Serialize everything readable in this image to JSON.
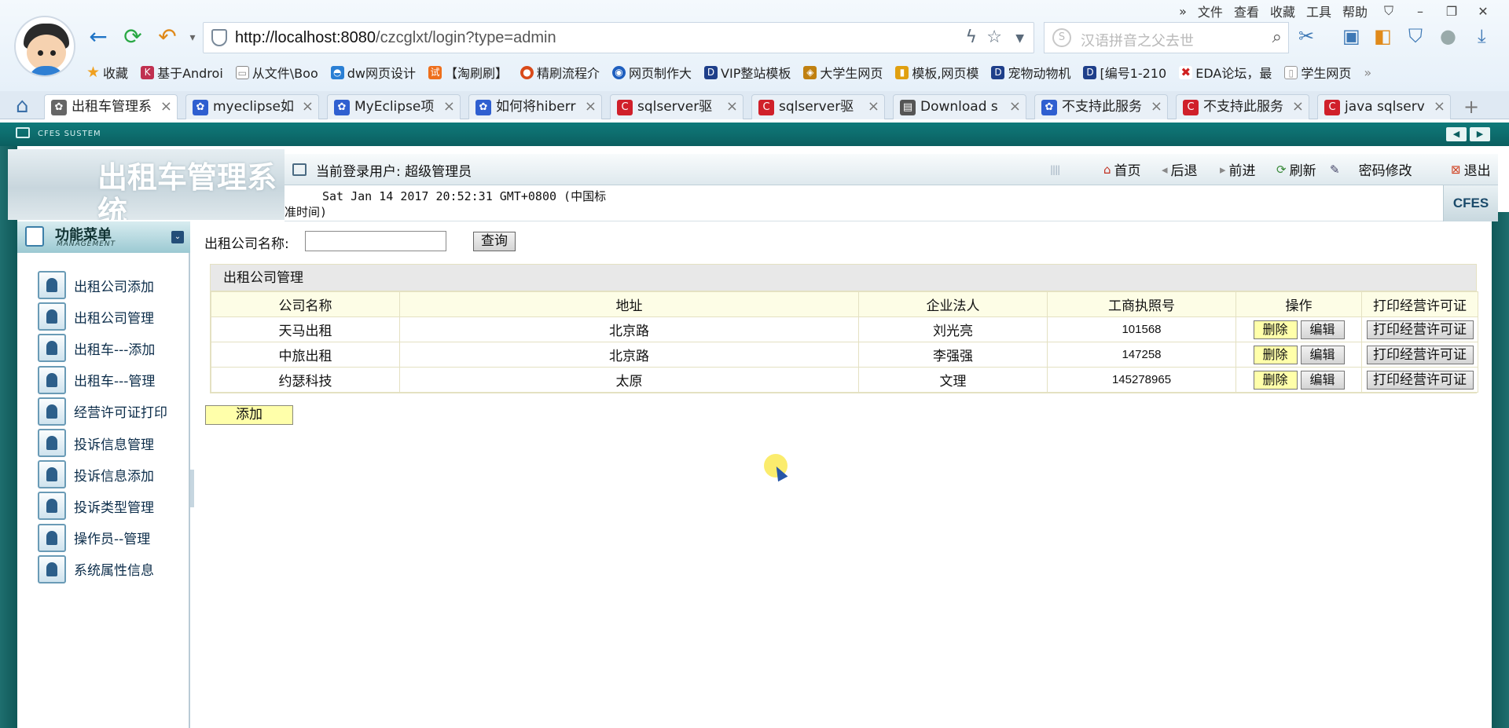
{
  "browser": {
    "url_host": "http://localhost:8080",
    "url_path": "/czcglxt/login?type=admin",
    "search_placeholder": "汉语拼音之父去世",
    "menubar": [
      "文件",
      "查看",
      "收藏",
      "工具",
      "帮助"
    ],
    "bookmarks": [
      "收藏",
      "基于Androi",
      "从文件\\Boo",
      "dw网页设计",
      "【淘刷刷】",
      "精刷流程介",
      "网页制作大",
      "VIP整站模板",
      "大学生网页",
      "模板,网页模",
      "宠物动物机",
      "[编号1-210",
      "EDA论坛，最",
      "学生网页"
    ],
    "tabs": [
      {
        "label": "出租车管理系",
        "active": true,
        "color": "#666"
      },
      {
        "label": "myeclipse如",
        "active": false,
        "color": "#2f5fd0"
      },
      {
        "label": "MyEclipse项",
        "active": false,
        "color": "#2f5fd0"
      },
      {
        "label": "如何将hiberr",
        "active": false,
        "color": "#2f5fd0"
      },
      {
        "label": "sqlserver驱",
        "active": false,
        "color": "#d0202a"
      },
      {
        "label": "sqlserver驱",
        "active": false,
        "color": "#d0202a"
      },
      {
        "label": "Download s",
        "active": false,
        "color": "#555"
      },
      {
        "label": "不支持此服务",
        "active": false,
        "color": "#2f5fd0"
      },
      {
        "label": "不支持此服务",
        "active": false,
        "color": "#d0202a"
      },
      {
        "label": "java sqlserv",
        "active": false,
        "color": "#d0202a"
      }
    ]
  },
  "app": {
    "system_label": "CFES SUSTEM",
    "logo_text": "出租车管理系统",
    "current_user_label": "当前登录用户: 超级管理员",
    "timestamp": "Sat Jan 14 2017 20:52:31 GMT+0800 (中国标准时间)",
    "badge": "CFES",
    "top_nav": [
      {
        "label": "首页",
        "icon": "home-icon"
      },
      {
        "label": "后退",
        "icon": "back-icon"
      },
      {
        "label": "前进",
        "icon": "forward-icon"
      },
      {
        "label": "刷新",
        "icon": "refresh-icon"
      },
      {
        "label": "密码修改",
        "icon": "password-icon"
      },
      {
        "label": "退出",
        "icon": "exit-icon"
      }
    ]
  },
  "sidebar": {
    "title": "功能菜单",
    "subtitle": "MANAGEMENT",
    "items": [
      {
        "label": "出租公司添加"
      },
      {
        "label": "出租公司管理"
      },
      {
        "label": "出租车---添加"
      },
      {
        "label": "出租车---管理"
      },
      {
        "label": "经营许可证打印"
      },
      {
        "label": "投诉信息管理"
      },
      {
        "label": "投诉信息添加"
      },
      {
        "label": "投诉类型管理"
      },
      {
        "label": "操作员--管理"
      },
      {
        "label": "系统属性信息"
      }
    ]
  },
  "main": {
    "query_label": "出租公司名称:",
    "query_value": "",
    "query_button": "查询",
    "table_caption": "出租公司管理",
    "columns": [
      "公司名称",
      "地址",
      "企业法人",
      "工商执照号",
      "操作",
      "打印经营许可证"
    ],
    "rows": [
      {
        "name": "天马出租",
        "address": "北京路",
        "legal": "刘光亮",
        "license": "101568"
      },
      {
        "name": "中旅出租",
        "address": "北京路",
        "legal": "李强强",
        "license": "147258"
      },
      {
        "name": "约瑟科技",
        "address": "太原",
        "legal": "文理",
        "license": "145278965"
      }
    ],
    "delete_label": "删除",
    "edit_label": "编辑",
    "print_label": "打印经营许可证",
    "add_button": "添加"
  }
}
